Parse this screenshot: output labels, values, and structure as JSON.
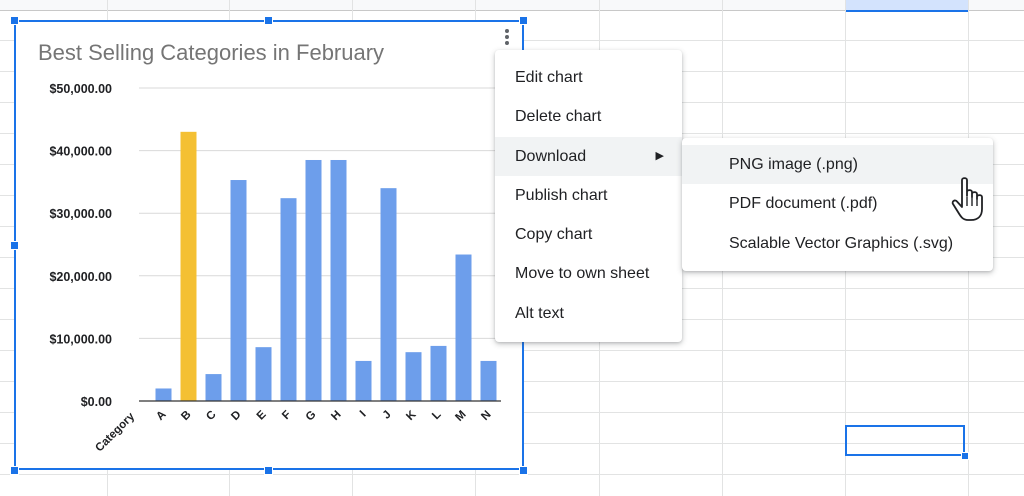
{
  "chart": {
    "menu_icon": "kebab-menu-icon"
  },
  "chart_data": {
    "type": "bar",
    "title": "Best Selling Categories in February",
    "xlabel": "Category",
    "ylabel": "",
    "categories": [
      "A",
      "B",
      "C",
      "D",
      "E",
      "F",
      "G",
      "H",
      "I",
      "J",
      "K",
      "L",
      "M",
      "N"
    ],
    "values": [
      2000,
      43000,
      4300,
      35300,
      8600,
      32400,
      38500,
      38500,
      6400,
      34000,
      7800,
      8800,
      23400,
      6400
    ],
    "highlight": {
      "category": "B",
      "color": "#f4c033"
    },
    "bar_color": "#6d9eeb",
    "ylim": [
      0,
      50000
    ],
    "yticks": [
      0,
      10000,
      20000,
      30000,
      40000,
      50000
    ],
    "ytick_labels": [
      "$0.00",
      "$10,000.00",
      "$20,000.00",
      "$30,000.00",
      "$40,000.00",
      "$50,000.00"
    ],
    "grid": true,
    "legend": "none"
  },
  "context_menu": {
    "items": [
      {
        "label": "Edit chart"
      },
      {
        "label": "Delete chart"
      },
      {
        "label": "Download",
        "submenu_arrow": "▶",
        "active": true
      },
      {
        "label": "Publish chart"
      },
      {
        "label": "Copy chart"
      },
      {
        "label": "Move to own sheet"
      },
      {
        "label": "Alt text"
      }
    ]
  },
  "download_submenu": {
    "items": [
      {
        "label": "PNG image (.png)",
        "active": true
      },
      {
        "label": "PDF document (.pdf)"
      },
      {
        "label": "Scalable Vector Graphics (.svg)"
      }
    ]
  },
  "colors": {
    "selection": "#1a73e8",
    "grid": "#e2e3e3"
  },
  "cursor": {
    "icon": "hand-pointer-icon"
  }
}
